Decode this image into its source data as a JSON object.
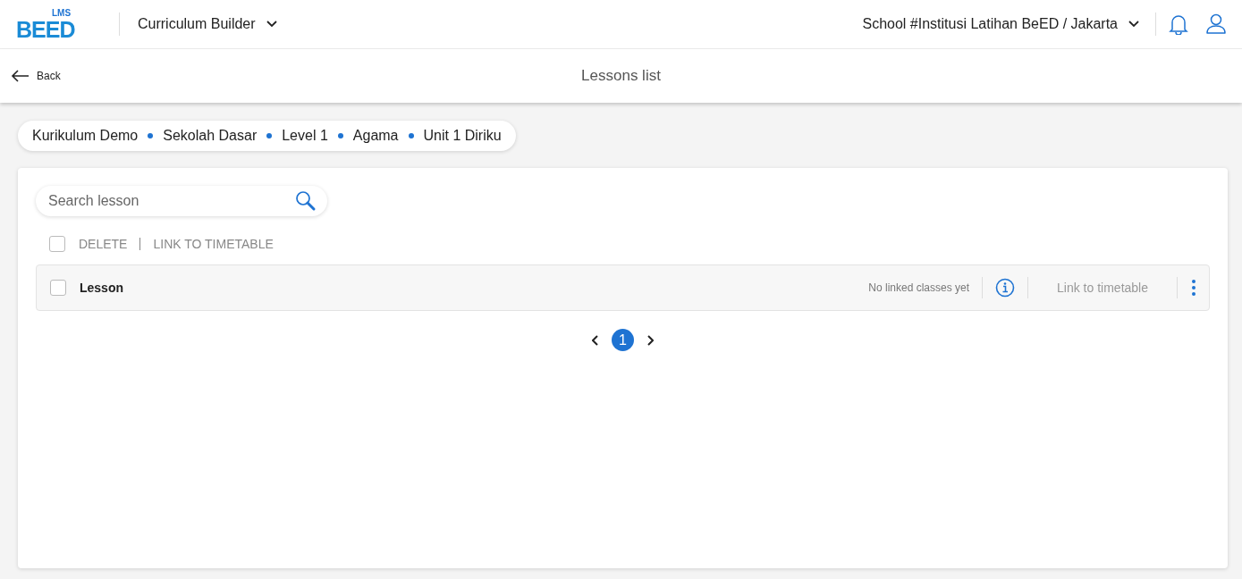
{
  "header": {
    "logo": {
      "wordmark": "BEED",
      "sub": "LMS"
    },
    "app_menu": "Curriculum Builder",
    "school": "School #Institusi Latihan BeED / Jakarta"
  },
  "subheader": {
    "back": "Back",
    "title": "Lessons list"
  },
  "breadcrumb": [
    "Kurikulum Demo",
    "Sekolah Dasar",
    "Level 1",
    "Agama",
    "Unit 1 Diriku"
  ],
  "search": {
    "placeholder": "Search lesson"
  },
  "bulk_actions": {
    "checked": false,
    "actions": [
      "DELETE",
      "LINK TO TIMETABLE"
    ]
  },
  "lessons": [
    {
      "name": "Lesson",
      "checked": false,
      "linked": "No linked classes yet",
      "link_action": "Link to timetable"
    }
  ],
  "pagination": {
    "pages": [
      {
        "label": "1",
        "selected": true
      }
    ]
  }
}
